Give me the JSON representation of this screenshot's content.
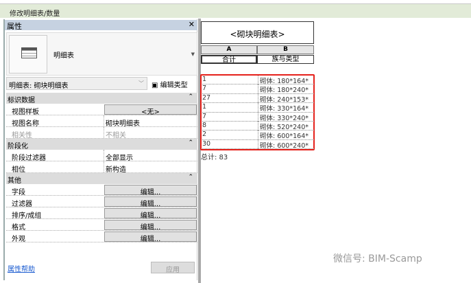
{
  "ribbon": {
    "context": "修改明细表/数量"
  },
  "properties": {
    "title": "属性",
    "close": "✕",
    "type_name": "明细表",
    "selector": "明细表: 砌块明细表",
    "edit_type": "编辑类型",
    "sections": [
      {
        "title": "标识数据",
        "rows": [
          {
            "k": "视图样板",
            "v": "<无>"
          },
          {
            "k": "视图名称",
            "v": "砌块明细表"
          },
          {
            "k": "相关性",
            "v": "不相关"
          }
        ]
      },
      {
        "title": "阶段化",
        "rows": [
          {
            "k": "阶段过滤器",
            "v": "全部显示"
          },
          {
            "k": "相位",
            "v": "新构造"
          }
        ]
      },
      {
        "title": "其他",
        "rows": [
          {
            "k": "字段",
            "v": "编辑..."
          },
          {
            "k": "过滤器",
            "v": "编辑..."
          },
          {
            "k": "排序/成组",
            "v": "编辑..."
          },
          {
            "k": "格式",
            "v": "编辑..."
          },
          {
            "k": "外观",
            "v": "编辑..."
          }
        ]
      }
    ],
    "help": "属性帮助",
    "apply": "应用"
  },
  "schedule": {
    "title": "<砌块明细表>",
    "col_letters": [
      "A",
      "B"
    ],
    "col_headers": [
      "合计",
      "族与类型"
    ],
    "rows": [
      {
        "a": "1",
        "b": "砌体: 180*164*"
      },
      {
        "a": "7",
        "b": "砌体: 180*240*"
      },
      {
        "a": "27",
        "b": "砌体: 240*153*"
      },
      {
        "a": "1",
        "b": "砌体: 330*164*"
      },
      {
        "a": "7",
        "b": "砌体: 330*240*"
      },
      {
        "a": "8",
        "b": "砌体: 520*240*"
      },
      {
        "a": "2",
        "b": "砌体: 600*164*"
      },
      {
        "a": "30",
        "b": "砌体: 600*240*"
      }
    ],
    "total": "总计: 83",
    "highlight_color": "#e5201a"
  },
  "watermark": "微信号: BIM-Scamp"
}
